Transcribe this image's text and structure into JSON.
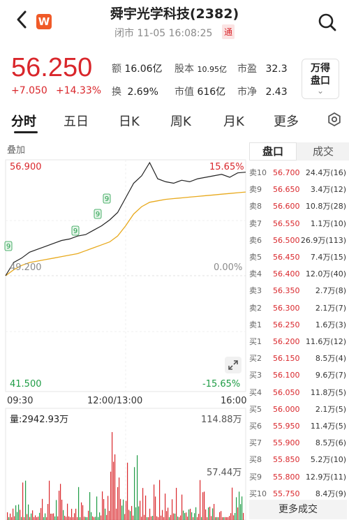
{
  "header": {
    "back_icon": "chevron-left-icon",
    "logo_text": "W",
    "title": "舜宇光学科技(2382)",
    "status": "闭市 11-05 16:08:25",
    "badge": "通",
    "search_icon": "search-icon"
  },
  "quote": {
    "price": "56.250",
    "change": "+7.050",
    "change_pct": "+14.33%",
    "stats": [
      {
        "label": "额",
        "value": "16.06亿"
      },
      {
        "label": "股本",
        "value": "10.95亿"
      },
      {
        "label": "市盈",
        "value": "32.3"
      },
      {
        "label": "换",
        "value": "2.69%"
      },
      {
        "label": "市值",
        "value": "616亿"
      },
      {
        "label": "市净",
        "value": "2.43"
      }
    ],
    "wande_line1": "万得",
    "wande_line2": "盘口",
    "wande_chevron": "⌄"
  },
  "tabs": [
    "分时",
    "五日",
    "日K",
    "周K",
    "月K",
    "更多"
  ],
  "chart": {
    "overlay_label": "叠加",
    "y_high": "56.900",
    "y_mid": "49.200",
    "y_low": "41.500",
    "pct_high": "15.65%",
    "pct_mid": "0.00%",
    "pct_low": "-15.65%",
    "time_labels": [
      "09:30",
      "12:00/13:00",
      "16:00"
    ],
    "volume_label": "量:2942.93万",
    "volume_max": "114.88万",
    "volume_mid": "57.44万",
    "marker_label": "9"
  },
  "chart_data": {
    "type": "line",
    "ylim": [
      41.5,
      56.9
    ],
    "series": [
      {
        "values": [
          49.2,
          50.1,
          50.4,
          50.8,
          51.0,
          51.2,
          51.4,
          51.6,
          51.7,
          51.9,
          52.0,
          52.3,
          52.6,
          53.0,
          53.5,
          54.5,
          55.5,
          56.0,
          56.9,
          55.8,
          55.6,
          55.5,
          55.7,
          55.6,
          55.8,
          55.9,
          56.0,
          56.1,
          55.9,
          56.2,
          56.25
        ]
      },
      {
        "values": [
          49.2,
          49.6,
          49.9,
          50.1,
          50.2,
          50.3,
          50.4,
          50.5,
          50.6,
          50.7,
          50.9,
          51.1,
          51.3,
          51.5,
          51.9,
          52.6,
          53.4,
          53.9,
          54.2,
          54.3,
          54.4,
          54.45,
          54.5,
          54.55,
          54.6,
          54.65,
          54.7,
          54.75,
          54.8,
          54.85,
          54.9
        ]
      }
    ]
  },
  "orderbook": {
    "tab_active": "盘口",
    "tab_other": "成交",
    "rows": [
      {
        "label": "卖10",
        "price": "56.700",
        "qty": "24.4万(16)"
      },
      {
        "label": "卖9",
        "price": "56.650",
        "qty": "3.4万(12)"
      },
      {
        "label": "卖8",
        "price": "56.600",
        "qty": "10.8万(28)"
      },
      {
        "label": "卖7",
        "price": "56.550",
        "qty": "1.1万(10)"
      },
      {
        "label": "卖6",
        "price": "56.500",
        "qty": "26.9万(113)"
      },
      {
        "label": "卖5",
        "price": "56.450",
        "qty": "7.4万(15)"
      },
      {
        "label": "卖4",
        "price": "56.400",
        "qty": "12.0万(40)"
      },
      {
        "label": "卖3",
        "price": "56.350",
        "qty": "2.7万(8)"
      },
      {
        "label": "卖2",
        "price": "56.300",
        "qty": "2.1万(7)"
      },
      {
        "label": "卖1",
        "price": "56.250",
        "qty": "1.6万(3)"
      },
      {
        "label": "买1",
        "price": "56.200",
        "qty": "11.6万(12)"
      },
      {
        "label": "买2",
        "price": "56.150",
        "qty": "8.5万(4)"
      },
      {
        "label": "买3",
        "price": "56.100",
        "qty": "9.6万(7)"
      },
      {
        "label": "买4",
        "price": "56.050",
        "qty": "11.8万(5)"
      },
      {
        "label": "买5",
        "price": "56.000",
        "qty": "2.1万(5)"
      },
      {
        "label": "买6",
        "price": "55.950",
        "qty": "11.4万(5)"
      },
      {
        "label": "买7",
        "price": "55.900",
        "qty": "8.5万(6)"
      },
      {
        "label": "买8",
        "price": "55.850",
        "qty": "5.2万(10)"
      },
      {
        "label": "买9",
        "price": "55.800",
        "qty": "12.9万(11)"
      },
      {
        "label": "买10",
        "price": "55.750",
        "qty": "8.4万(9)"
      }
    ],
    "more_label": "更多成交"
  },
  "colors": {
    "up": "#d9262b",
    "down": "#1e9c45",
    "avg": "#e8a91c"
  }
}
